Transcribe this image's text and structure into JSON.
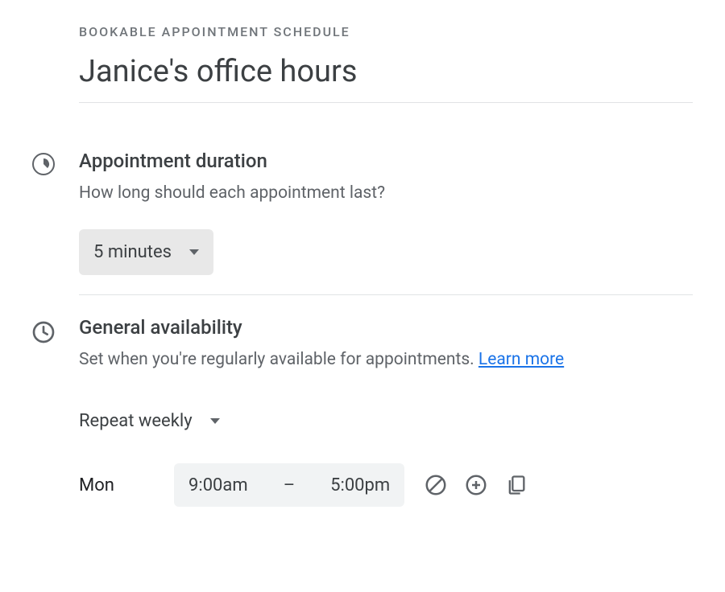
{
  "header": {
    "label": "BOOKABLE APPOINTMENT SCHEDULE",
    "title": "Janice's office hours"
  },
  "duration": {
    "title": "Appointment duration",
    "sub": "How long should each appointment last?",
    "selected": "5 minutes"
  },
  "availability": {
    "title": "General availability",
    "sub": "Set when you're regularly available for appointments. ",
    "learn_link": "Learn more",
    "repeat": "Repeat weekly",
    "days": [
      {
        "day": "Mon",
        "start": "9:00am",
        "end": "5:00pm"
      }
    ]
  }
}
